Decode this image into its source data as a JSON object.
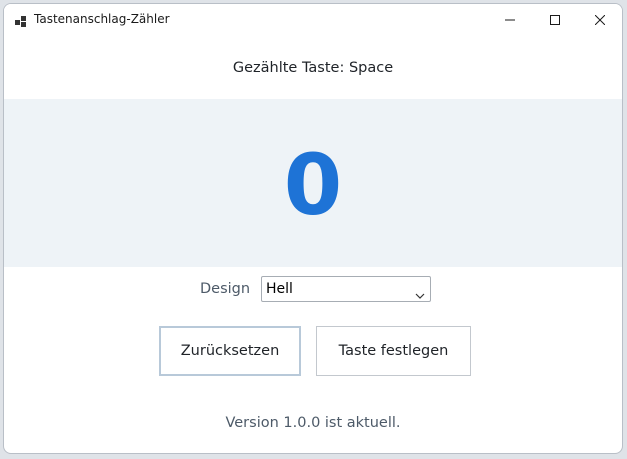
{
  "window": {
    "title": "Tastenanschlag-Zähler",
    "controls": {
      "minimize_icon": "minimize-icon",
      "maximize_icon": "maximize-icon",
      "close_icon": "close-icon"
    }
  },
  "main": {
    "counted_key_label": "Gezählte Taste: Space",
    "counter_value": "0",
    "design": {
      "label": "Design",
      "selected": "Hell"
    },
    "buttons": {
      "reset_label": "Zurücksetzen",
      "set_key_label": "Taste festlegen"
    },
    "version_status": "Version 1.0.0 ist aktuell."
  },
  "colors": {
    "accent": "#1e73d6",
    "counter_panel_bg": "#eef3f7",
    "muted_text": "#4d5a68"
  }
}
